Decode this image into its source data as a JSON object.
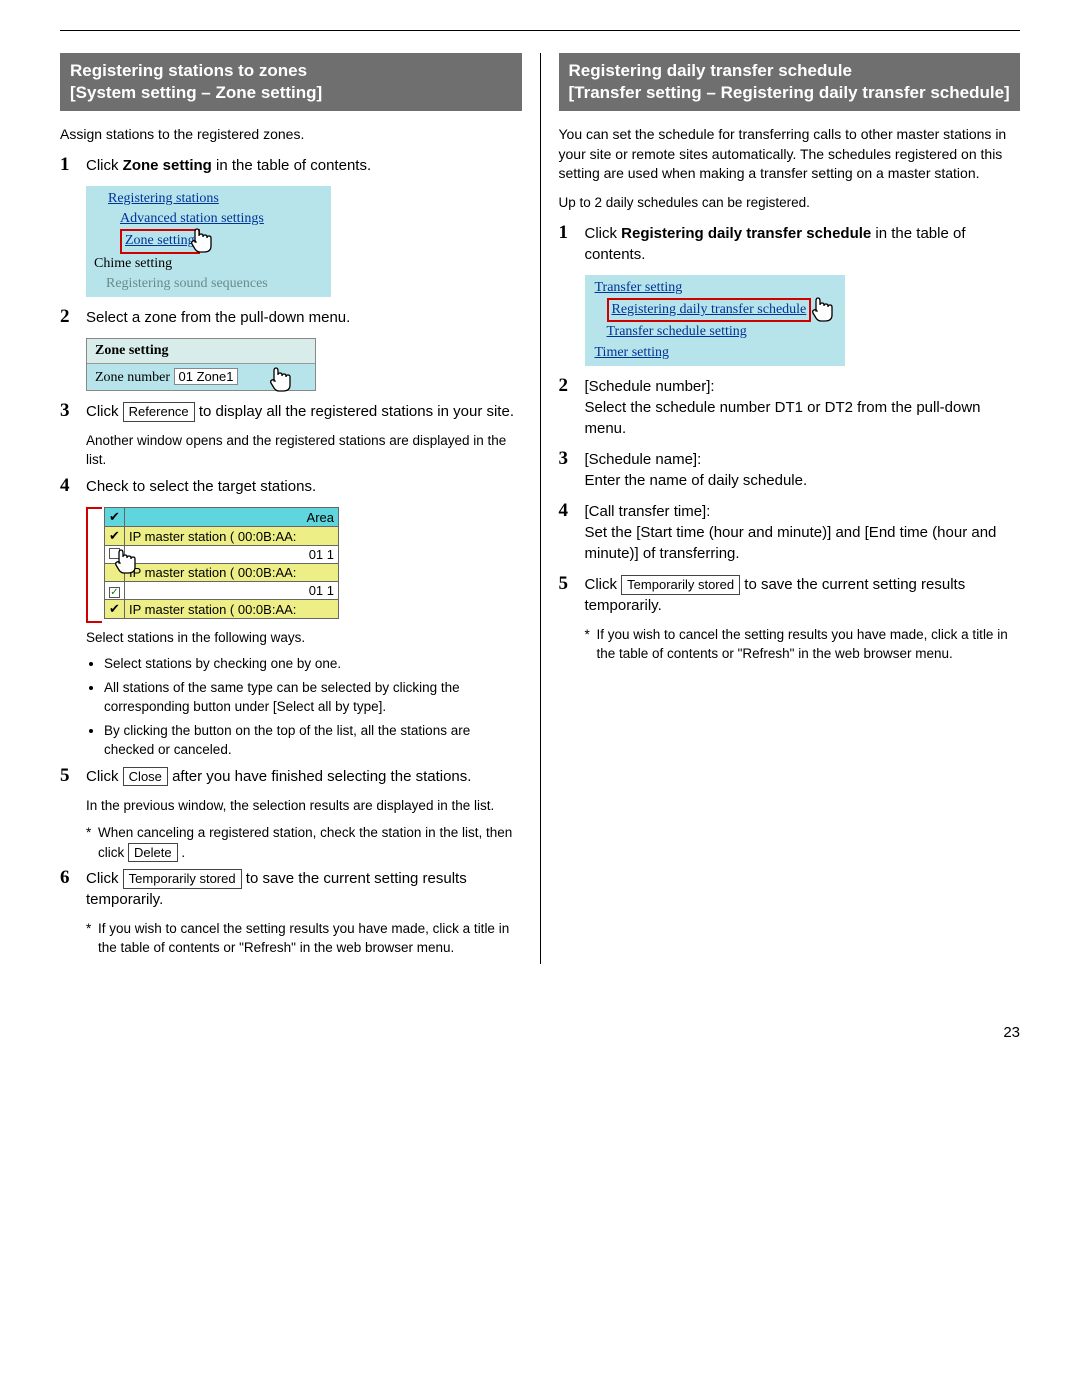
{
  "page_number": "23",
  "left": {
    "heading_l1": "Registering stations to zones",
    "heading_l2": "[System setting – Zone setting]",
    "intro": "Assign stations to the registered zones.",
    "step1": {
      "pre": "Click ",
      "bold": "Zone setting",
      "post": " in the table of contents."
    },
    "toc_fig": {
      "l1": "Registering stations",
      "l2": "Advanced station settings",
      "l3": "Zone setting",
      "l4": "Chime setting",
      "l5": "Registering sound sequences"
    },
    "step2": "Select a zone from the pull-down menu.",
    "zone_fig": {
      "header": "Zone setting",
      "label": "Zone number",
      "value": "01 Zone1"
    },
    "step3": {
      "pre": "Click ",
      "btn": "Reference",
      "post": " to display all the registered stations in your site."
    },
    "step3_note": "Another window opens and the registered stations are displayed in the list.",
    "step4": "Check to select the target stations.",
    "station_fig": {
      "hdr_r": "Area",
      "row1": "IP master station ( 00:0B:AA:",
      "row2": "01 1",
      "row3": "IP master station ( 00:0B:AA:",
      "row4": "01 1",
      "row5": "IP master station ( 00:0B:AA:"
    },
    "step4_note_lead": "Select stations in the following ways.",
    "step4_bullets": {
      "b1": "Select stations by checking one by one.",
      "b2": "All stations of the same type can be selected by clicking the corresponding button under [Select all by type].",
      "b3": "By clicking the button on the top of the list, all the stations are checked or canceled."
    },
    "step5": {
      "pre": "Click ",
      "btn": "Close",
      "post": " after you have finished selecting the stations."
    },
    "step5_note": "In the previous window, the selection results are displayed in the list.",
    "step5_star": {
      "pre": "When canceling a registered station, check the station in the list, then click ",
      "btn": "Delete",
      "post": " ."
    },
    "step6": {
      "pre": "Click ",
      "btn": "Temporarily stored",
      "post": " to save the current setting results temporarily."
    },
    "step6_star": "If you wish to cancel the setting results you have made, click a title in the table of contents or \"Refresh\" in the web browser menu."
  },
  "right": {
    "heading_l1": "Registering daily transfer schedule",
    "heading_l2": "[Transfer setting – Registering daily transfer schedule]",
    "intro1": "You can set the schedule for transferring calls to other master stations in your site or remote sites automatically. The schedules registered on this setting are used when making a transfer setting on a master station.",
    "intro2": "Up to 2 daily schedules can be registered.",
    "step1": {
      "pre": "Click ",
      "bold": "Registering daily transfer schedule",
      "post": " in the table of contents."
    },
    "toc_fig": {
      "l1": "Transfer setting",
      "l2": "Registering daily transfer schedule",
      "l3": "Transfer schedule setting",
      "l4": "Timer setting"
    },
    "step2_a": "[Schedule number]:",
    "step2_b": "Select the schedule number DT1 or DT2 from the pull-down menu.",
    "step3_a": "[Schedule name]:",
    "step3_b": "Enter the name of daily schedule.",
    "step4_a": "[Call transfer time]:",
    "step4_b": "Set the [Start time (hour and minute)] and [End time (hour and minute)] of transferring.",
    "step5": {
      "pre": "Click ",
      "btn": "Temporarily stored",
      "post": " to save the current setting results temporarily."
    },
    "step5_star": "If you wish to cancel the setting results you have made, click a title in the table of contents or \"Refresh\" in the web browser menu."
  }
}
